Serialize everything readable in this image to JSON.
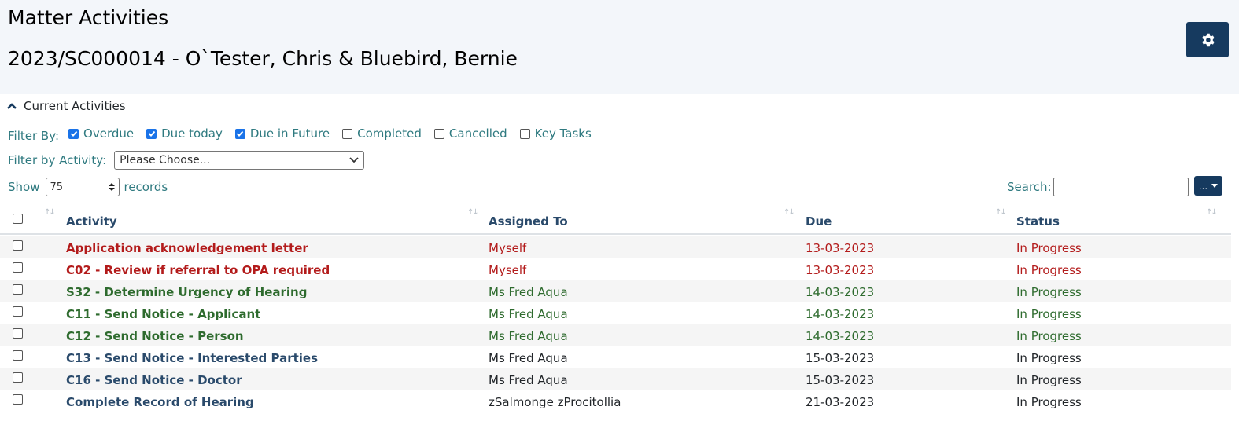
{
  "header": {
    "title": "Matter Activities",
    "matter": "2023/SC000014 - O`Tester, Chris & Bluebird, Bernie"
  },
  "panel": {
    "label": "Current Activities"
  },
  "filters": {
    "label": "Filter By:",
    "options": [
      {
        "label": "Overdue",
        "checked": true
      },
      {
        "label": "Due today",
        "checked": true
      },
      {
        "label": "Due in Future",
        "checked": true
      },
      {
        "label": "Completed",
        "checked": false
      },
      {
        "label": "Cancelled",
        "checked": false
      },
      {
        "label": "Key Tasks",
        "checked": false
      }
    ]
  },
  "activity_filter": {
    "label": "Filter by Activity:",
    "value": "Please Choose..."
  },
  "paging": {
    "show_label": "Show",
    "value": "75",
    "records_label": "records"
  },
  "search": {
    "label": "Search:",
    "value": "",
    "more_label": "..."
  },
  "table": {
    "columns": [
      "Activity",
      "Assigned To",
      "Due",
      "Status"
    ],
    "rows": [
      {
        "activity": "Application acknowledgement letter",
        "assigned": "Myself",
        "due": "13-03-2023",
        "status": "In Progress",
        "tone": "red"
      },
      {
        "activity": "C02 - Review if referral to OPA required",
        "assigned": "Myself",
        "due": "13-03-2023",
        "status": "In Progress",
        "tone": "red"
      },
      {
        "activity": "S32 - Determine Urgency of Hearing",
        "assigned": "Ms Fred Aqua",
        "due": "14-03-2023",
        "status": "In Progress",
        "tone": "green"
      },
      {
        "activity": "C11 - Send Notice - Applicant",
        "assigned": "Ms Fred Aqua",
        "due": "14-03-2023",
        "status": "In Progress",
        "tone": "green"
      },
      {
        "activity": "C12 - Send Notice - Person",
        "assigned": "Ms Fred Aqua",
        "due": "14-03-2023",
        "status": "In Progress",
        "tone": "green"
      },
      {
        "activity": "C13 - Send Notice - Interested Parties",
        "assigned": "Ms Fred Aqua",
        "due": "15-03-2023",
        "status": "In Progress",
        "tone": "blue"
      },
      {
        "activity": "C16 - Send Notice - Doctor",
        "assigned": "Ms Fred Aqua",
        "due": "15-03-2023",
        "status": "In Progress",
        "tone": "blue"
      },
      {
        "activity": "Complete Record of Hearing",
        "assigned": "zSalmonge zProcitollia",
        "due": "21-03-2023",
        "status": "In Progress",
        "tone": "blue"
      }
    ]
  },
  "colors": {
    "header_bg": "#f3f6fa",
    "button_bg": "#163a5f",
    "label_teal": "#2f7a80",
    "overdue_red": "#b31b1b",
    "future_green": "#2e6b2e",
    "link_blue": "#2a4a6b"
  },
  "icons": [
    "gear-icon",
    "chevron-up-icon",
    "chevron-down-icon",
    "spinner-arrows-icon",
    "sort-arrows-icon",
    "caret-down-icon"
  ]
}
